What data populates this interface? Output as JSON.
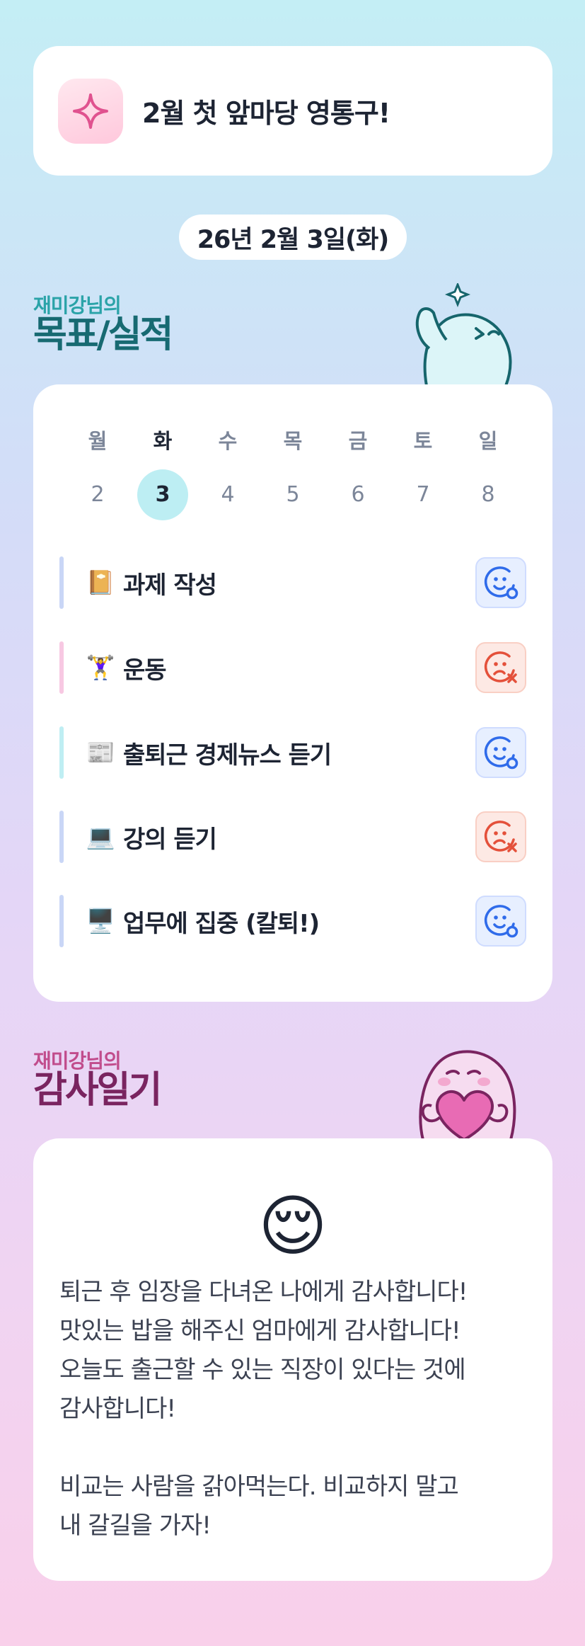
{
  "banner": {
    "icon": "sparkle-icon",
    "text": "2월 첫 앞마당 영통구!"
  },
  "date": "26년 2월 3일(화)",
  "goals": {
    "subtitle": "재미강님의",
    "title": "목표/실적",
    "weekdays": [
      "월",
      "화",
      "수",
      "목",
      "금",
      "토",
      "일"
    ],
    "dates": [
      "2",
      "3",
      "4",
      "5",
      "6",
      "7",
      "8"
    ],
    "selected_index": 1,
    "tasks": [
      {
        "emoji": "📔",
        "label": "과제 작성",
        "status": "done",
        "status_icon": "smile-check-icon",
        "bar_color": "#c9d6f6"
      },
      {
        "emoji": "🏋️‍♀️",
        "label": "운동",
        "status": "missed",
        "status_icon": "sad-x-icon",
        "bar_color": "#f7c8e2"
      },
      {
        "emoji": "📰",
        "label": "출퇴근 경제뉴스 듣기",
        "status": "done",
        "status_icon": "smile-check-icon",
        "bar_color": "#bfeef3"
      },
      {
        "emoji": "💻",
        "label": "강의 듣기",
        "status": "missed",
        "status_icon": "sad-x-icon",
        "bar_color": "#c9d6f6"
      },
      {
        "emoji": "🖥️",
        "label": "업무에 집중 (칼퇴!)",
        "status": "done",
        "status_icon": "smile-check-icon",
        "bar_color": "#c9d6f6"
      }
    ]
  },
  "gratitude": {
    "subtitle": "재미강님의",
    "title": "감사일기",
    "emoji": "😌",
    "text": "퇴근 후 임장을 다녀온 나에게 감사합니다!\n맛있는 밥을 해주신 엄마에게 감사합니다!\n오늘도 출근할 수 있는 직장이 있다는 것에\n감사합니다!\n\n비교는 사람을 갉아먹는다. 비교하지 말고\n내 갈길을 가자!"
  },
  "colors": {
    "done": "#2f6bea",
    "missed": "#e4503a",
    "selected_day": "#bdeef3"
  }
}
